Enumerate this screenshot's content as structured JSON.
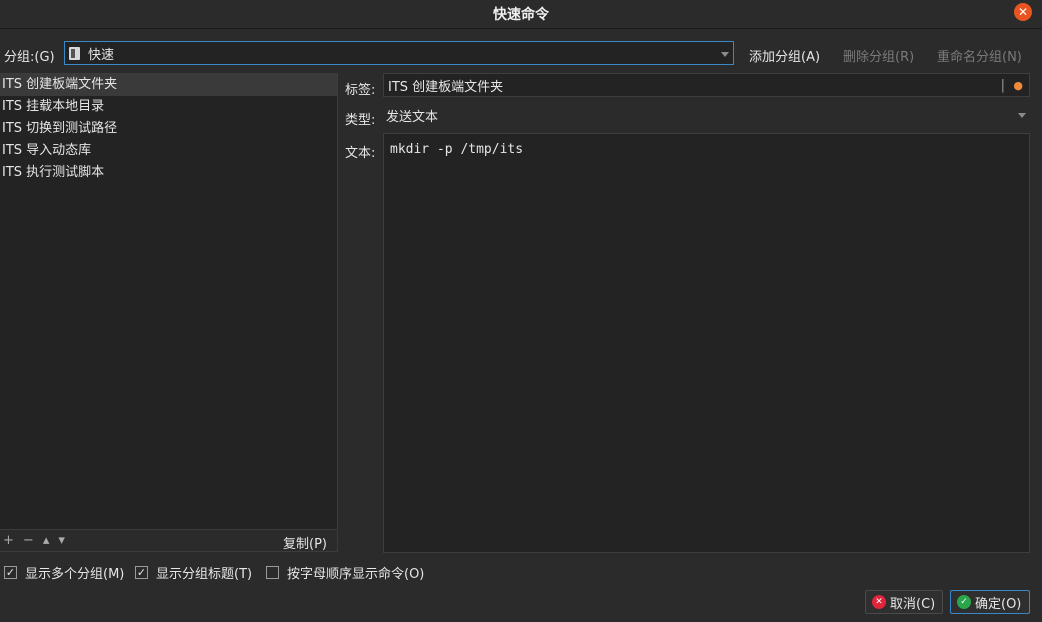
{
  "window": {
    "title": "快速命令",
    "close_icon": "close-icon"
  },
  "header": {
    "group_label": "分组:(G)",
    "group_value": "快速",
    "add_group": "添加分组(A)",
    "delete_group": "删除分组(R)",
    "rename_group": "重命名分组(N)"
  },
  "commands": [
    {
      "label": "ITS 创建板端文件夹",
      "selected": true
    },
    {
      "label": "ITS 挂载本地目录",
      "selected": false
    },
    {
      "label": "ITS 切换到测试路径",
      "selected": false
    },
    {
      "label": "ITS 导入动态库",
      "selected": false
    },
    {
      "label": "ITS 执行测试脚本",
      "selected": false
    }
  ],
  "list_toolbar": {
    "add": "+",
    "remove": "−",
    "move_up": "▴",
    "move_down": "▾",
    "copy": "复制(P)"
  },
  "editor": {
    "tag_label": "标签:",
    "tag_value": "ITS 创建板端文件夹",
    "type_label": "类型:",
    "type_value": "发送文本",
    "text_label": "文本:",
    "text_value": "mkdir -p /tmp/its"
  },
  "options": {
    "show_multiple_groups": {
      "label": "显示多个分组(M)",
      "checked": true
    },
    "show_group_title": {
      "label": "显示分组标题(T)",
      "checked": true
    },
    "sort_alpha": {
      "label": "按字母顺序显示命令(O)",
      "checked": false
    }
  },
  "buttons": {
    "cancel": "取消(C)",
    "ok": "确定(O)"
  },
  "colors": {
    "accent": "#3a88c8",
    "close": "#e95420",
    "cancel": "#e0243a",
    "ok": "#2aa54a"
  }
}
